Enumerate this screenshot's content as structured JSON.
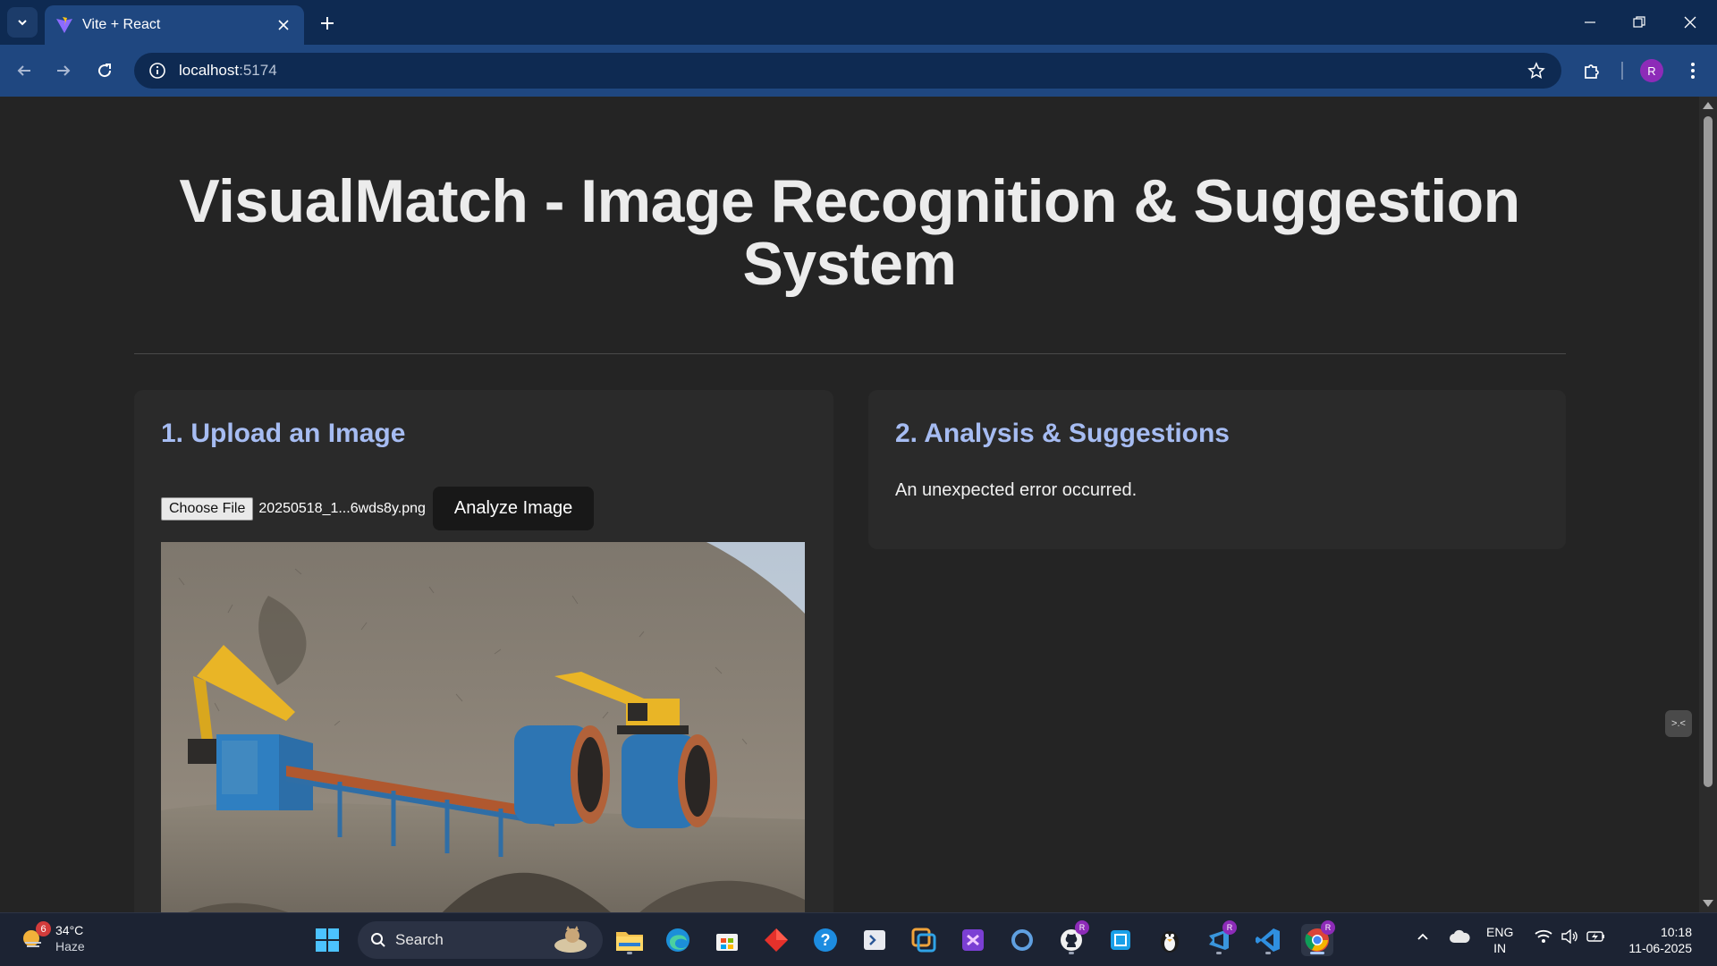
{
  "browser": {
    "tab_title": "Vite + React",
    "url_host": "localhost",
    "url_port": ":5174",
    "profile_initial": "R"
  },
  "page": {
    "title": "VisualMatch - Image Recognition & Suggestion System",
    "upload_card": {
      "heading": "1. Upload an Image",
      "choose_file_label": "Choose File",
      "file_name": "20250518_1...6wds8y.png",
      "analyze_label": "Analyze Image"
    },
    "analysis_card": {
      "heading": "2. Analysis & Suggestions",
      "message": "An unexpected error occurred."
    },
    "side_widget_label": ">.<"
  },
  "taskbar": {
    "weather_temp": "34°C",
    "weather_cond": "Haze",
    "weather_badge": "6",
    "search_label": "Search",
    "badge_r": "R",
    "lang_top": "ENG",
    "lang_bottom": "IN",
    "time": "10:18",
    "date": "11-06-2025"
  },
  "colors": {
    "accent_heading": "#a6bcf2",
    "chrome_blue": "#1f4780",
    "page_bg": "#242424"
  }
}
